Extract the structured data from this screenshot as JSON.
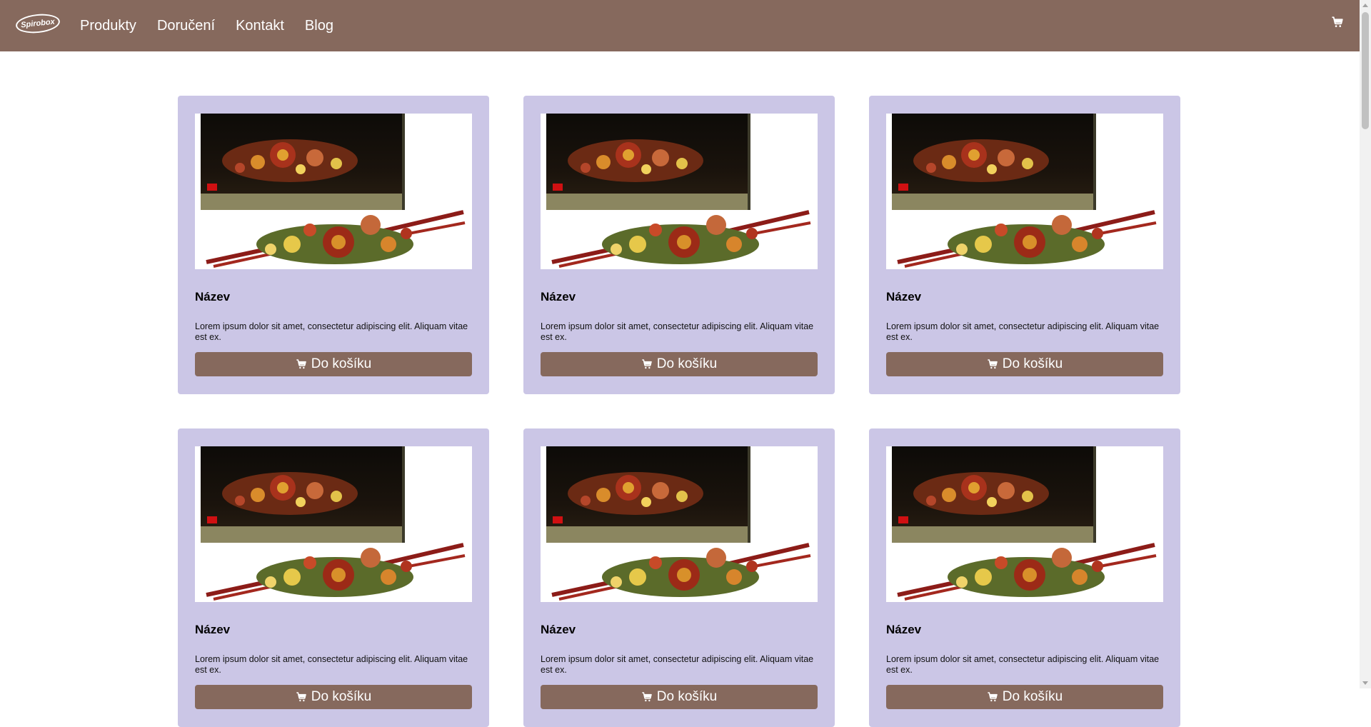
{
  "navbar": {
    "logo_text": "Spirobox",
    "links": [
      "Produkty",
      "Doručení",
      "Kontakt",
      "Blog"
    ],
    "background": "#86695d",
    "cart_icon": "cart-icon"
  },
  "products": [
    {
      "title": "Název",
      "description": "Lorem ipsum dolor sit amet, consectetur adipiscing elit. Aliquam vitae est ex.",
      "button_label": "Do košíku"
    },
    {
      "title": "Název",
      "description": "Lorem ipsum dolor sit amet, consectetur adipiscing elit. Aliquam vitae est ex.",
      "button_label": "Do košíku"
    },
    {
      "title": "Název",
      "description": "Lorem ipsum dolor sit amet, consectetur adipiscing elit. Aliquam vitae est ex.",
      "button_label": "Do košíku"
    },
    {
      "title": "Název",
      "description": "Lorem ipsum dolor sit amet, consectetur adipiscing elit. Aliquam vitae est ex.",
      "button_label": "Do košíku"
    },
    {
      "title": "Název",
      "description": "Lorem ipsum dolor sit amet, consectetur adipiscing elit. Aliquam vitae est ex.",
      "button_label": "Do košíku"
    },
    {
      "title": "Název",
      "description": "Lorem ipsum dolor sit amet, consectetur adipiscing elit. Aliquam vitae est ex.",
      "button_label": "Do košíku"
    }
  ],
  "colors": {
    "card_background": "#cbc6e6",
    "button_background": "#86695d"
  }
}
